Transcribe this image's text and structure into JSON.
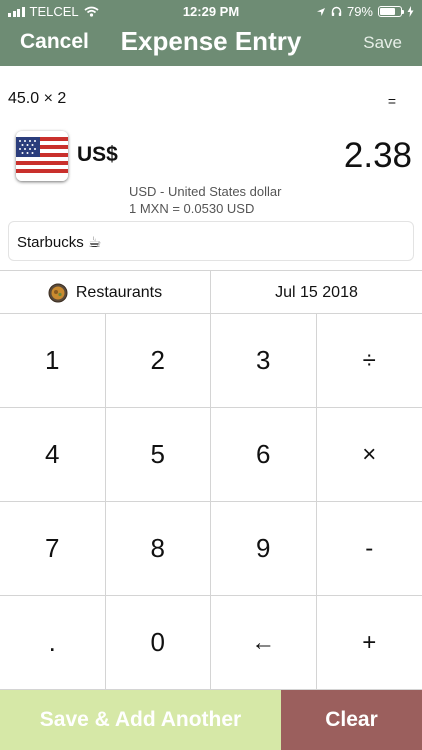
{
  "status_bar": {
    "carrier": "TELCEL",
    "time": "12:29 PM",
    "battery_percent": "79%",
    "battery_level": 0.79,
    "icons": [
      "signal-icon",
      "wifi-icon",
      "location-arrow-icon",
      "headphones-icon",
      "battery-icon",
      "charging-bolt-icon"
    ]
  },
  "nav": {
    "cancel_label": "Cancel",
    "title": "Expense Entry",
    "save_label": "Save"
  },
  "entry": {
    "expression": "45.0 × 2",
    "equals_label": "=",
    "currency_code": "US$",
    "flag_icon": "us-flag-icon",
    "amount": "2.38",
    "currency_name": "USD - United States dollar",
    "exchange_rate": "1 MXN = 0.0530 USD",
    "note": "Starbucks ☕"
  },
  "category": {
    "icon": "plate-icon",
    "label": "Restaurants"
  },
  "date_label": "Jul 15 2018",
  "keypad": {
    "keys": [
      {
        "label": "1",
        "name": "key-1"
      },
      {
        "label": "2",
        "name": "key-2"
      },
      {
        "label": "3",
        "name": "key-3"
      },
      {
        "label": "÷",
        "name": "key-divide"
      },
      {
        "label": "4",
        "name": "key-4"
      },
      {
        "label": "5",
        "name": "key-5"
      },
      {
        "label": "6",
        "name": "key-6"
      },
      {
        "label": "×",
        "name": "key-multiply"
      },
      {
        "label": "7",
        "name": "key-7"
      },
      {
        "label": "8",
        "name": "key-8"
      },
      {
        "label": "9",
        "name": "key-9"
      },
      {
        "label": "-",
        "name": "key-minus"
      },
      {
        "label": ".",
        "name": "key-decimal"
      },
      {
        "label": "0",
        "name": "key-0"
      },
      {
        "label": "←",
        "name": "key-backspace"
      },
      {
        "label": "+",
        "name": "key-plus"
      }
    ]
  },
  "bottom": {
    "save_add_label": "Save & Add Another",
    "clear_label": "Clear"
  },
  "colors": {
    "header_bg": "#6e8c74",
    "save_add_bg": "#d6e8a7",
    "clear_bg": "#9b5f5d"
  }
}
